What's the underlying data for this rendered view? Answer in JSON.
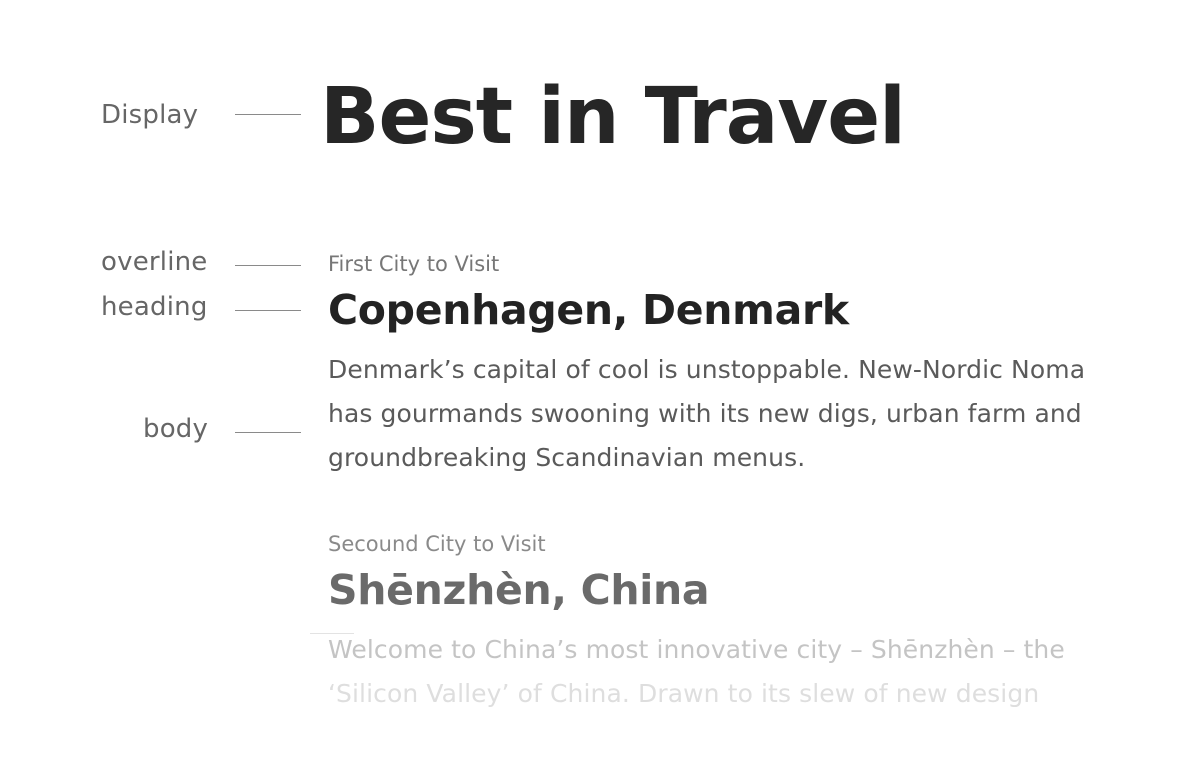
{
  "annotations": {
    "display": "Display",
    "overline": "overline",
    "heading": "heading",
    "body": "body"
  },
  "display": {
    "title": "Best in Travel"
  },
  "cities": [
    {
      "overline": "First City to Visit",
      "heading": "Copenhagen, Denmark",
      "body_lines": [
        "Denmark’s capital of cool is unstoppable. New-Nordic Noma",
        "has gourmands swooning with its new digs, urban farm and",
        "groundbreaking Scandinavian menus."
      ]
    },
    {
      "overline": "Secound City to Visit",
      "heading": "Shēnzhèn, China",
      "body_lines": [
        "Welcome to China’s most innovative city – Shēnzhèn – the",
        "‘Silicon Valley’ of China. Drawn to its slew of new design"
      ]
    }
  ],
  "colors": {
    "text_dark": "#232323",
    "text_muted": "#666666",
    "rule": "#8a8a8a",
    "background": "#ffffff"
  }
}
